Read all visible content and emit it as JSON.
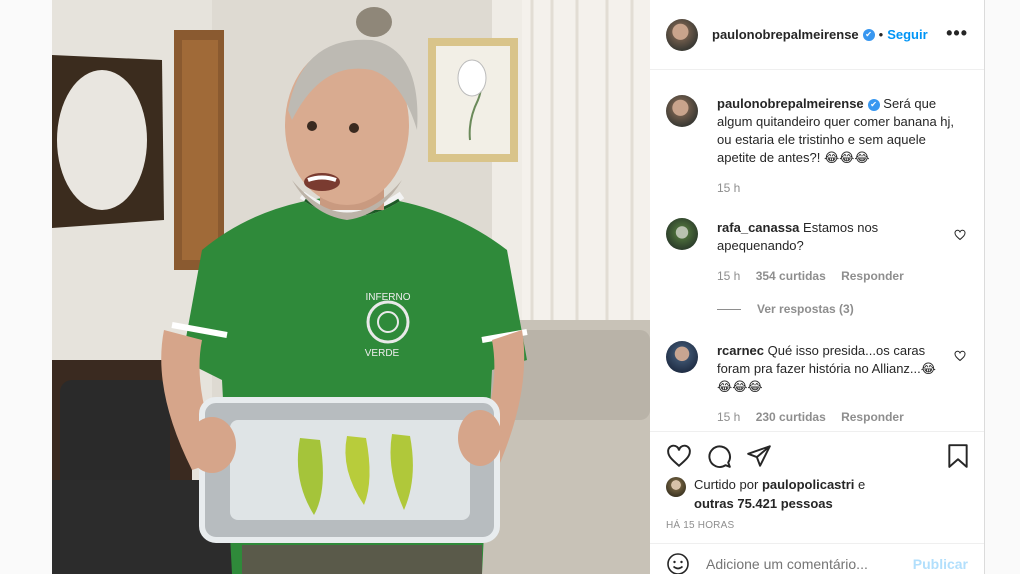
{
  "post": {
    "username": "paulonobrepalmeirense",
    "verified_icon": "verified-badge-icon",
    "separator": "•",
    "follow_label": "Seguir",
    "more_label": "•••",
    "caption": "Será que algum quitandeiro quer comer banana hj, ou estaria ele tristinho e sem aquele apetite de antes?! 😂😂😂",
    "caption_time": "15 h",
    "shirt_text": [
      "INFERNO",
      "VERDE"
    ]
  },
  "comments": [
    {
      "username": "rafa_canassa",
      "text": "Estamos nos apequenando?",
      "time": "15 h",
      "likes": "354 curtidas",
      "reply_label": "Responder",
      "view_replies": "Ver respostas (3)"
    },
    {
      "username": "rcarnec",
      "text": "Qué isso presida...os caras foram pra fazer história no Allianz...😂😂😂😂",
      "time": "15 h",
      "likes": "230 curtidas",
      "reply_label": "Responder"
    }
  ],
  "likes_line": {
    "prefix": "Curtido por",
    "user": "paulopolicastri",
    "and": "e",
    "others": "outras 75.421 pessoas"
  },
  "timestamp": "HÁ 15 HORAS",
  "add_comment": {
    "placeholder": "Adicione um comentário...",
    "publish_label": "Publicar"
  },
  "colors": {
    "accent": "#0095f6",
    "verified": "#3897f0",
    "muted": "#8e8e8e",
    "publish_disabled": "#b2dffc"
  }
}
